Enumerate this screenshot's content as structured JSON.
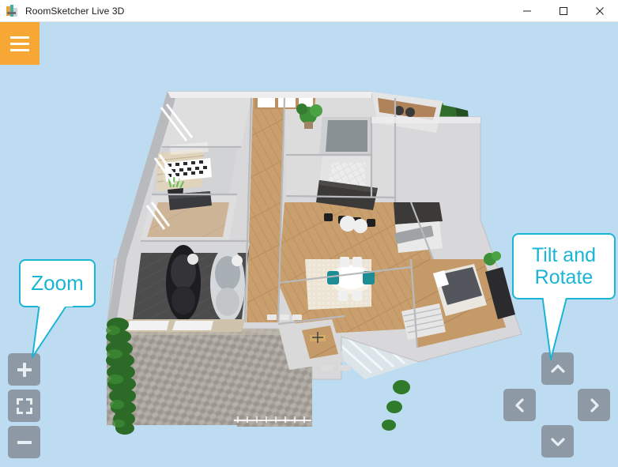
{
  "window": {
    "title": "RoomSketcher Live 3D",
    "icon": "roomsketcher-app-icon",
    "controls": {
      "minimize": "minimize-icon",
      "maximize": "maximize-icon",
      "close": "close-icon"
    }
  },
  "menu": {
    "label": "menu-icon",
    "color": "#F7A733"
  },
  "viewport": {
    "background_color": "#BEDCF1",
    "content": "3D floor plan of a two-storey house with garage, bedrooms, bathrooms, kitchen, living and dining rooms, a rear lawn with sun loungers and barbecue, an outdoor dining terrace, a cobblestone driveway and a row of trees."
  },
  "callouts": [
    {
      "id": "zoom-callout",
      "text": "Zoom",
      "color": "#1AB4D4",
      "points_to": "zoom-in-button"
    },
    {
      "id": "tilt-callout",
      "line1": "Tilt and",
      "line2": "Rotate",
      "color": "#1AB4D4",
      "points_to": "tilt-up-button"
    }
  ],
  "zoom_controls": {
    "button_color": "#8D99A5",
    "zoom_in": "plus-icon",
    "zoom_fit": "fullscreen-icon",
    "zoom_out": "minus-icon"
  },
  "navigation_controls": {
    "button_color": "#8D99A5",
    "tilt_up": "chevron-up-icon",
    "rotate_left": "chevron-left-icon",
    "rotate_right": "chevron-right-icon",
    "tilt_down": "chevron-down-icon"
  }
}
